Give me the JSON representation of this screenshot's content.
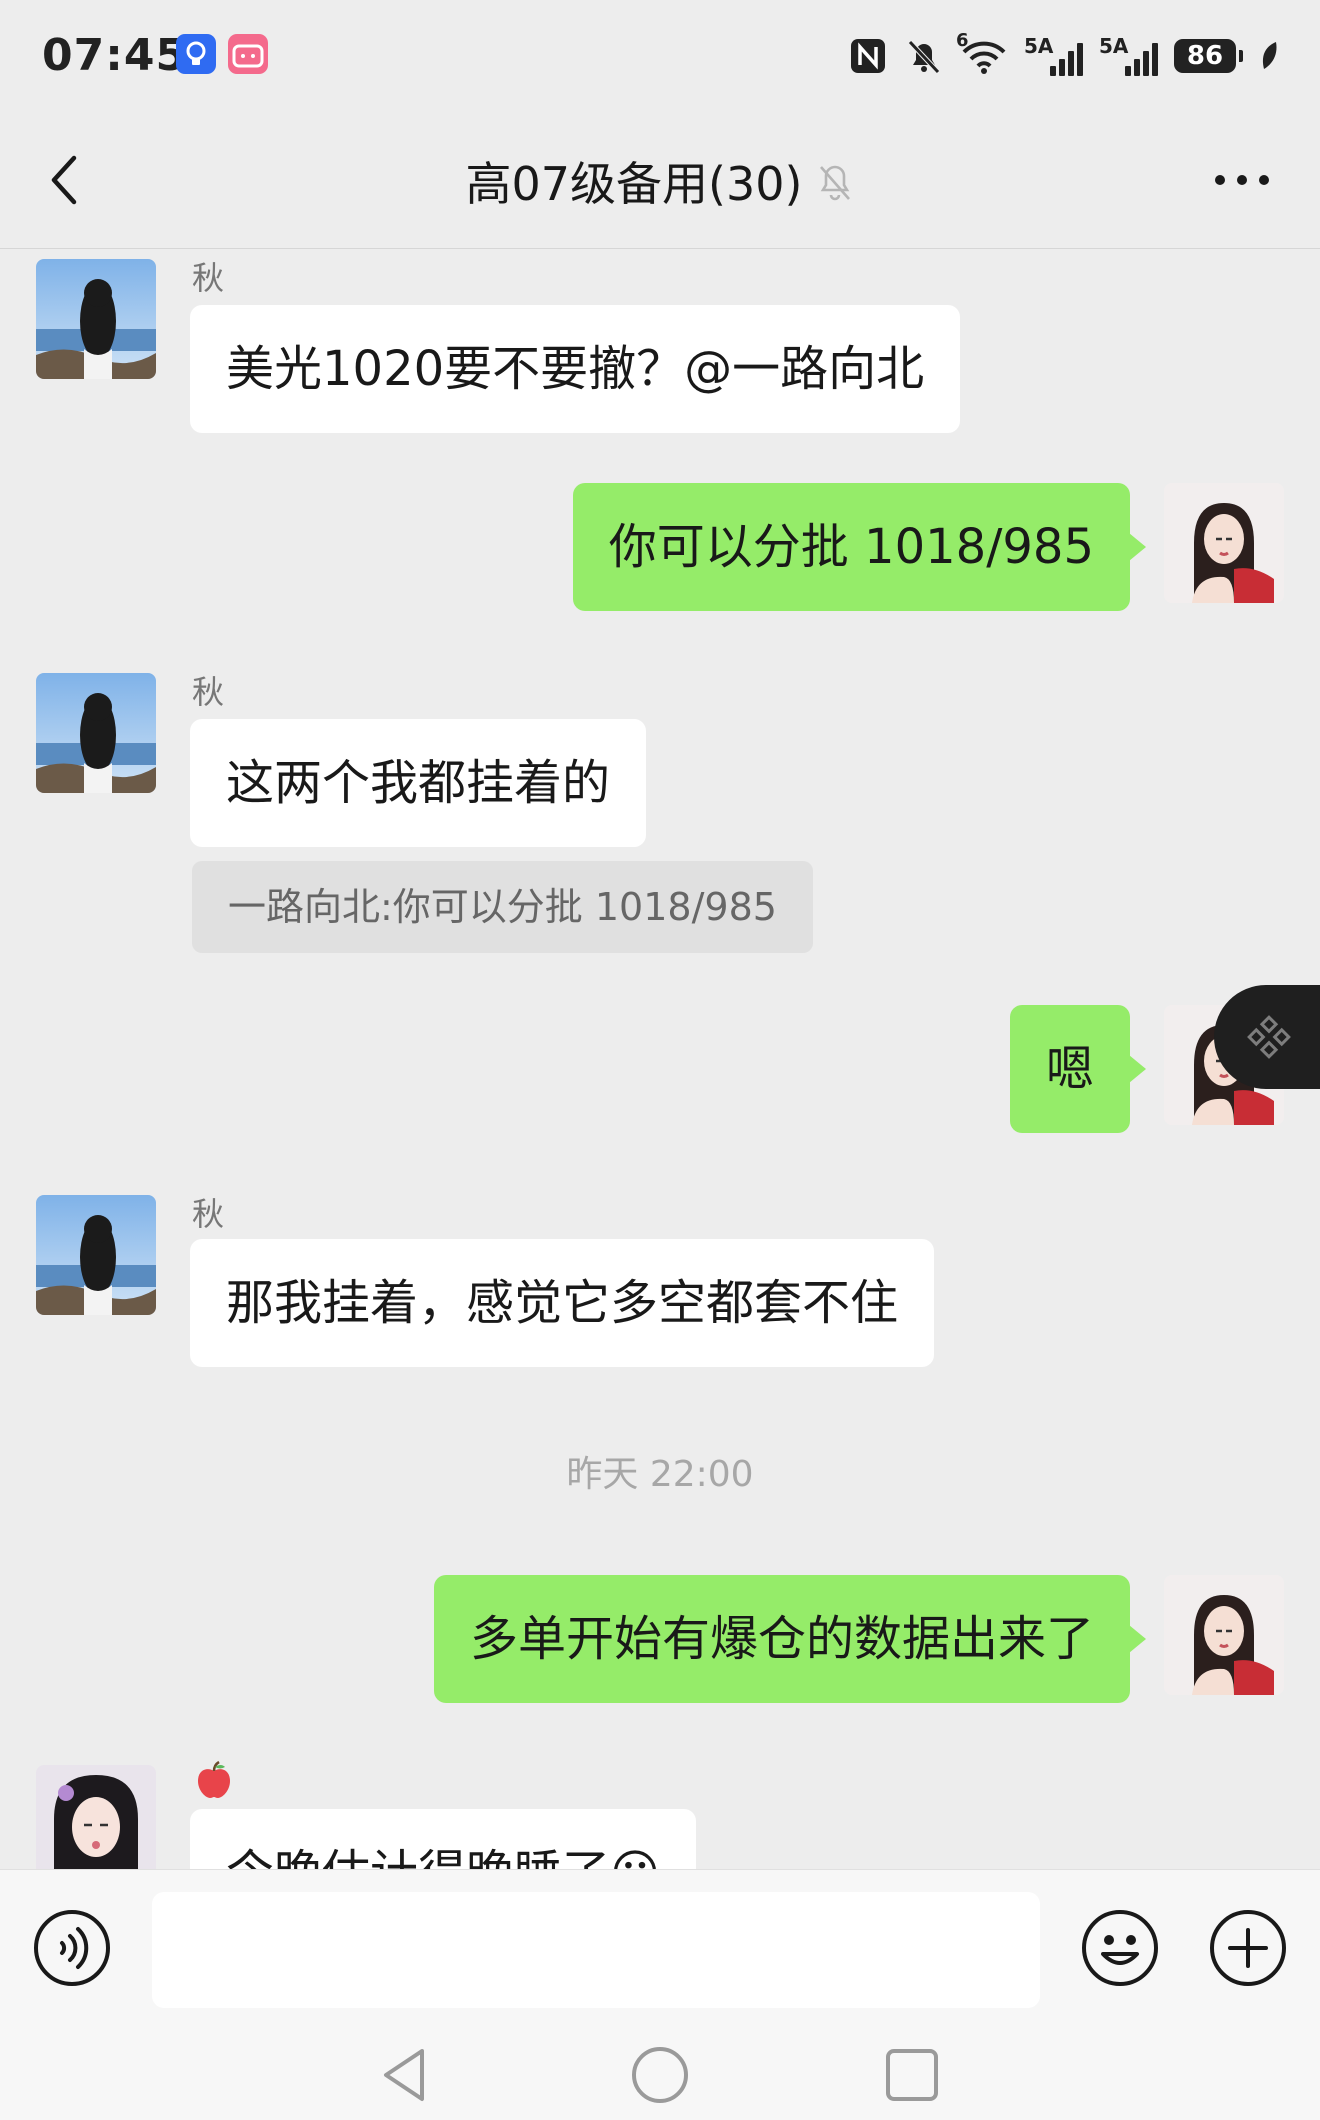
{
  "status_bar": {
    "time": "07:45",
    "signal1_label": "5A",
    "signal2_label": "5A",
    "wifi_label": "6",
    "battery": "86"
  },
  "header": {
    "title": "高07级备用(30)"
  },
  "messages": [
    {
      "sender": "秋",
      "text": "美光1020要不要撤？@一路向北"
    },
    {
      "text": "你可以分批  1018/985"
    },
    {
      "sender": "秋",
      "text": "这两个我都挂着的",
      "quote": "一路向北:你可以分批  1018/985"
    },
    {
      "text": "嗯"
    },
    {
      "sender": "秋",
      "text": "那我挂着，感觉它多空都套不住"
    },
    {
      "timestamp": "昨天 22:00"
    },
    {
      "text": "多单开始有爆仓的数据出来了"
    },
    {
      "sender_icon": "apple-emoji",
      "text": "今晚估计得晚睡了😐"
    }
  ],
  "colors": {
    "background": "#ededed",
    "bubble_out": "#95ec69",
    "bubble_in": "#ffffff"
  }
}
